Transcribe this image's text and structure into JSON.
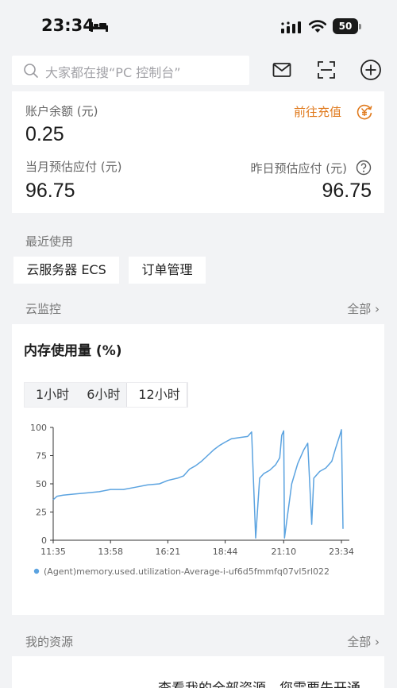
{
  "status_bar": {
    "time": "23:34",
    "battery": "50"
  },
  "search": {
    "placeholder": "大家都在搜“PC 控制台”"
  },
  "top_icons": [
    "mail-icon",
    "scan-icon",
    "add-icon"
  ],
  "balance": {
    "label": "账户余额 (元)",
    "value": "0.25",
    "recharge_label": "前往充值",
    "month_label": "当月预估应付 (元)",
    "month_value": "96.75",
    "yesterday_label": "昨日预估应付 (元)",
    "yesterday_value": "96.75"
  },
  "recent": {
    "title": "最近使用",
    "items": [
      "云服务器 ECS",
      "订单管理"
    ]
  },
  "monitor": {
    "title": "云监控",
    "see_all": "全部 ›",
    "chart_title": "内存使用量 (%)",
    "tabs": [
      "1小时",
      "6小时",
      "12小时"
    ],
    "active_tab": "12小时"
  },
  "resources": {
    "title": "我的资源",
    "see_all": "全部 ›",
    "message": "查看我的全部资源，您需要先开通"
  },
  "colors": {
    "accent": "#e07a1d",
    "series": "#5ba3e0"
  },
  "chart_data": {
    "type": "line",
    "title": "内存使用量 (%)",
    "ylim": [
      0,
      100
    ],
    "y_ticks": [
      "0",
      "25",
      "50",
      "75",
      "100"
    ],
    "x_ticks": [
      "11:35",
      "13:58",
      "16:21",
      "18:44",
      "21:10",
      "23:34"
    ],
    "grid": false,
    "legend_position": "bottom-left",
    "series": [
      {
        "name": "(Agent)memory.used.utilization-Average-i-uf6d5fmmfq07vl5rl022",
        "x": [
          "11:35",
          "11:45",
          "12:00",
          "12:30",
          "13:00",
          "13:30",
          "13:58",
          "14:30",
          "15:00",
          "15:30",
          "16:00",
          "16:21",
          "16:45",
          "17:00",
          "17:15",
          "17:30",
          "17:45",
          "18:00",
          "18:15",
          "18:30",
          "18:44",
          "19:00",
          "19:20",
          "19:40",
          "19:50",
          "20:00",
          "20:10",
          "20:20",
          "20:35",
          "20:50",
          "21:00",
          "21:05",
          "21:10",
          "21:12",
          "21:30",
          "21:45",
          "22:00",
          "22:10",
          "22:20",
          "22:25",
          "22:40",
          "22:55",
          "23:10",
          "23:20",
          "23:30",
          "23:34",
          "23:38"
        ],
        "y": [
          36,
          39,
          40,
          41,
          42,
          43,
          45,
          45,
          47,
          49,
          50,
          53,
          55,
          57,
          63,
          66,
          70,
          75,
          80,
          84,
          87,
          90,
          91,
          92,
          96,
          2,
          55,
          59,
          62,
          67,
          73,
          93,
          97,
          2,
          50,
          68,
          80,
          86,
          14,
          55,
          61,
          64,
          70,
          82,
          93,
          98,
          10
        ]
      }
    ]
  }
}
